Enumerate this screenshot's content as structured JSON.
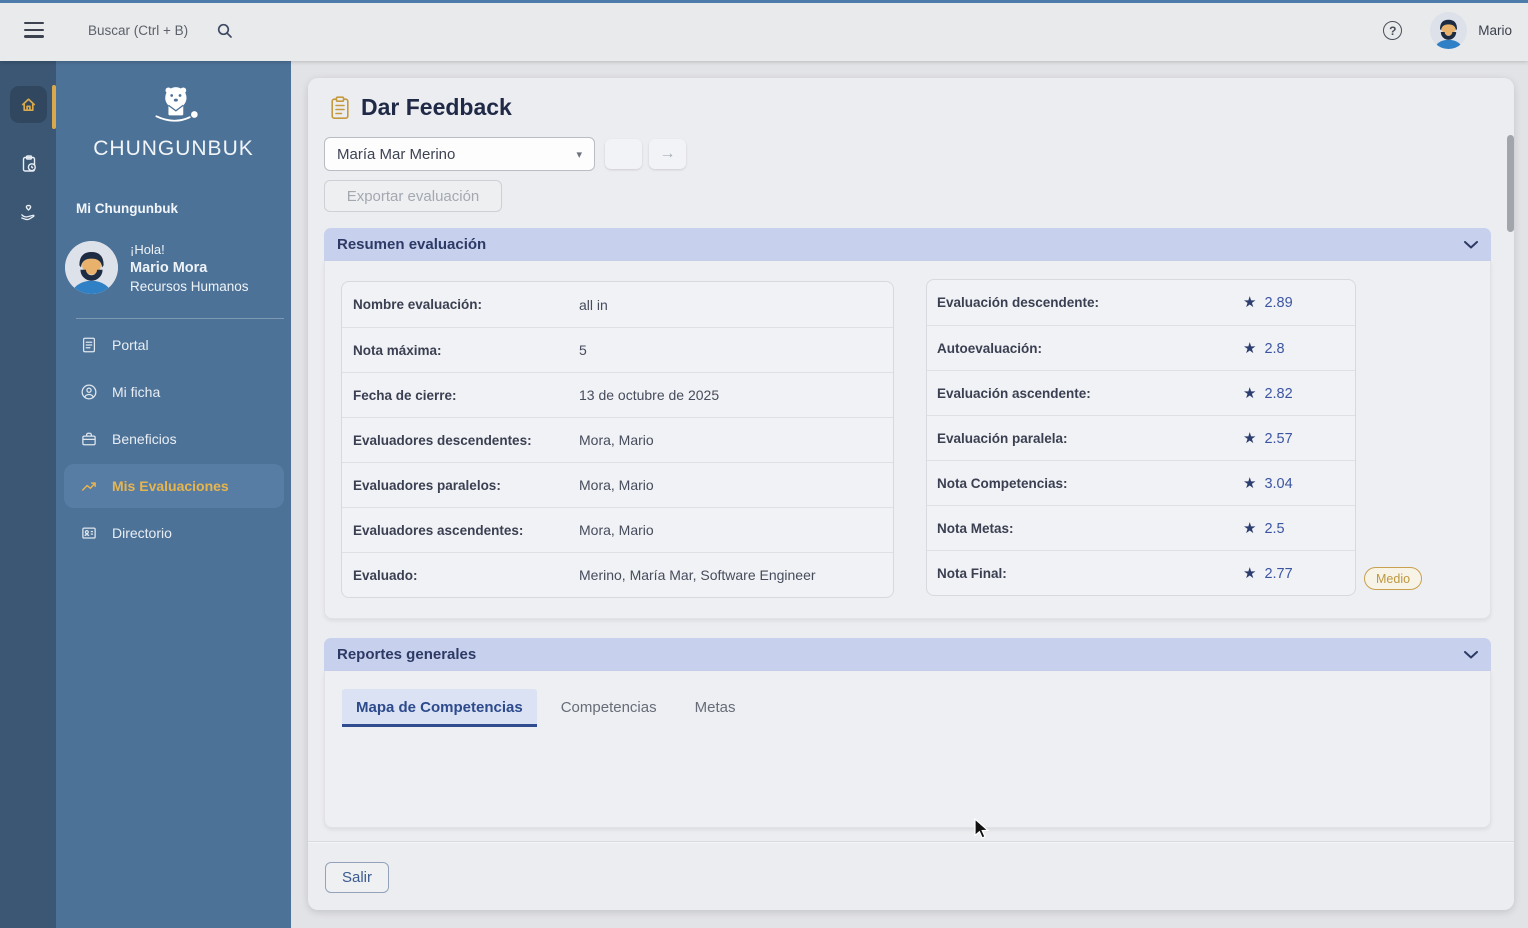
{
  "topbar": {
    "search_placeholder": "Buscar (Ctrl + B)",
    "user_name": "Mario"
  },
  "sidebar": {
    "brand": "CHUNGUNBUK",
    "section_label": "Mi Chungunbuk",
    "greeting": "¡Hola!",
    "user_name": "Mario Mora",
    "user_role": "Recursos Humanos",
    "items": [
      {
        "label": "Portal"
      },
      {
        "label": "Mi ficha"
      },
      {
        "label": "Beneficios"
      },
      {
        "label": "Mis Evaluaciones",
        "active": true
      },
      {
        "label": "Directorio"
      }
    ]
  },
  "main": {
    "title": "Dar Feedback",
    "employee_select": "María Mar Merino",
    "export_button": "Exportar evaluación",
    "exit_button": "Salir",
    "resumen": {
      "header": "Resumen evaluación",
      "details": [
        {
          "label": "Nombre evaluación:",
          "value": "all in"
        },
        {
          "label": "Nota máxima:",
          "value": "5"
        },
        {
          "label": "Fecha de cierre:",
          "value": "13 de octubre de 2025"
        },
        {
          "label": "Evaluadores descendentes:",
          "value": "Mora, Mario"
        },
        {
          "label": "Evaluadores paralelos:",
          "value": "Mora, Mario"
        },
        {
          "label": "Evaluadores ascendentes:",
          "value": "Mora, Mario"
        },
        {
          "label": "Evaluado:",
          "value": "Merino, María Mar, Software Engineer"
        }
      ],
      "scores": [
        {
          "label": "Evaluación descendente:",
          "value": "2.89"
        },
        {
          "label": "Autoevaluación:",
          "value": "2.8"
        },
        {
          "label": "Evaluación ascendente:",
          "value": "2.82"
        },
        {
          "label": "Evaluación paralela:",
          "value": "2.57"
        },
        {
          "label": "Nota Competencias:",
          "value": "3.04"
        },
        {
          "label": "Nota Metas:",
          "value": "2.5"
        },
        {
          "label": "Nota Final:",
          "value": "2.77",
          "badge": "Medio"
        }
      ]
    },
    "reportes": {
      "header": "Reportes generales",
      "tabs": [
        {
          "label": "Mapa de Competencias",
          "active": true
        },
        {
          "label": "Competencias"
        },
        {
          "label": "Metas"
        }
      ]
    }
  },
  "icons": {
    "star": "★",
    "caret_down": "▾",
    "arrow_right": "→",
    "help": "?"
  },
  "colors": {
    "accent_gold": "#d9a94c",
    "sidebar_blue": "#4d7297",
    "rail_blue": "#3b5774",
    "panel_header_lavender": "#c7d0ec",
    "score_blue": "#3c55a2",
    "active_tab_blue": "#2c4a8c",
    "badge_medio_gold": "#bd9840"
  }
}
